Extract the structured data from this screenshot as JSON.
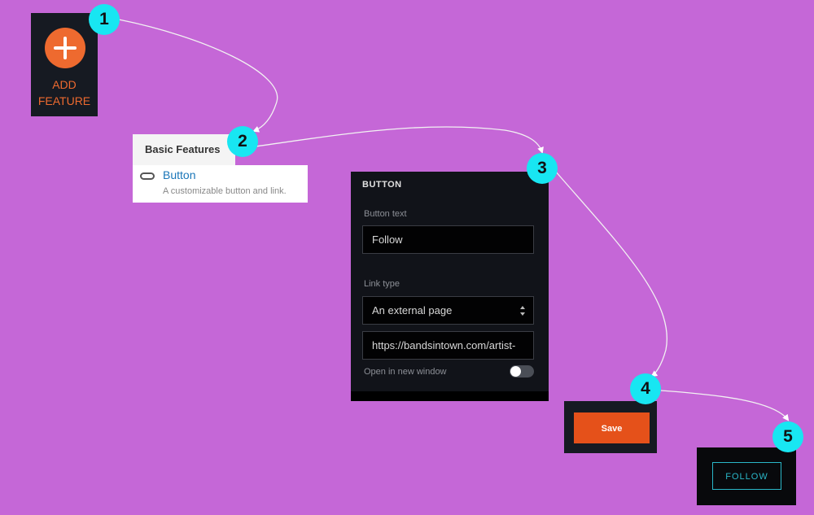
{
  "steps": [
    "1",
    "2",
    "3",
    "4",
    "5"
  ],
  "add_feature": {
    "label": "ADD\nFEATURE",
    "icon": "plus-circle-icon",
    "accent_color": "#ee6a2f"
  },
  "basic_features": {
    "tab_label": "Basic Features",
    "items": [
      {
        "icon": "pill-icon",
        "title": "Button",
        "description": "A customizable button and link."
      }
    ]
  },
  "button_panel": {
    "title": "BUTTON",
    "button_text_label": "Button text",
    "button_text_value": "Follow",
    "link_type_label": "Link type",
    "link_type_value": "An external page",
    "url_value": "https://bandsintown.com/artist-",
    "open_new_window_label": "Open in new window",
    "open_new_window_on": false
  },
  "save": {
    "label": "Save",
    "color": "#e5511a"
  },
  "follow": {
    "label": "FOLLOW",
    "color": "#2ab7c8"
  },
  "colors": {
    "background": "#c567d7",
    "badge": "#18e6f2"
  }
}
